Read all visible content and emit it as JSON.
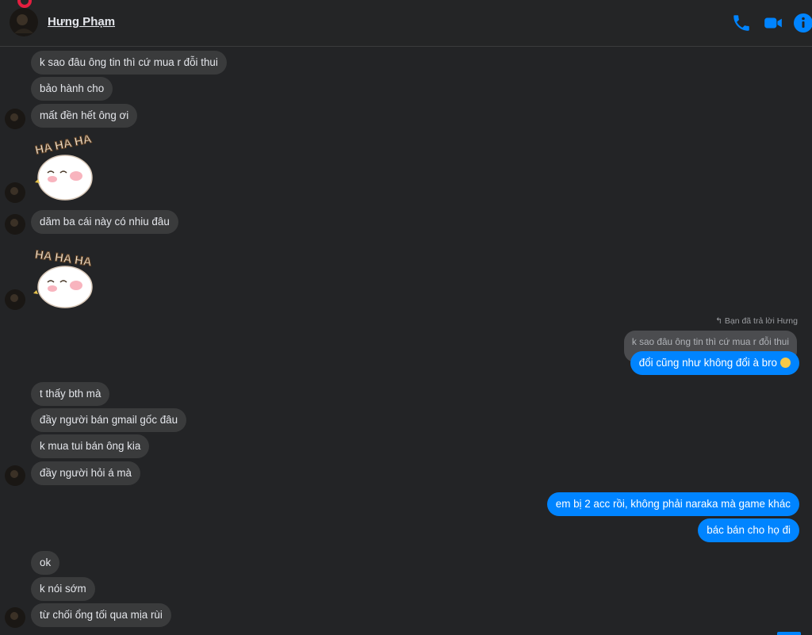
{
  "header": {
    "contact_name": "Hưng Phạm",
    "icons": [
      "phone-icon",
      "video-camera-icon",
      "info-icon"
    ],
    "accent": "#0084ff"
  },
  "messages": {
    "m1": "k sao đâu ông tin thì cứ mua r đỗi thui",
    "m2": "bảo hành cho",
    "m3": "mất đền hết ông ơi",
    "m4": "dăm ba cái này có nhiu đâu",
    "reply_hint": "Bạn đã trả lời Hưng",
    "quoted": "k sao đâu ông tin thì cứ mua r đỗi thui",
    "m5": "đổi cũng như không đổi à bro",
    "m6": "t thấy bth mà",
    "m7": "đầy người bán gmail gốc đâu",
    "m8": "k mua tui bán ông kia",
    "m9": "đầy người hỏi á mà",
    "m10": "em bị 2 acc rồi, không phải naraka mà game khác",
    "m11": "bác bán cho họ đi",
    "m12": "ok",
    "m13": "k nói sớm",
    "m14": "từ chối ổng tối qua mịa rùi"
  },
  "sticker": {
    "text": "HA HA HA",
    "icon": "laughing-bunny-sticker"
  },
  "colors": {
    "background": "#232426",
    "incoming_bubble": "#3a3b3c",
    "outgoing_bubble": "#0084ff"
  }
}
